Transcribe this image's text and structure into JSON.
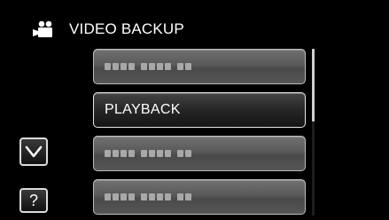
{
  "header": {
    "icon": "movie-camera-icon",
    "title": "VIDEO BACKUP"
  },
  "menu": {
    "items": [
      {
        "type": "date",
        "label": ""
      },
      {
        "type": "text",
        "label": "PLAYBACK",
        "selected": true
      },
      {
        "type": "date",
        "label": ""
      },
      {
        "type": "date",
        "label": ""
      }
    ]
  },
  "controls": {
    "down_icon": "chevron-down-icon",
    "help_label": "?"
  },
  "colors": {
    "background": "#000000",
    "button_gray": "#5a5a5a",
    "selected_dark": "#262626",
    "text": "#ffffff"
  }
}
